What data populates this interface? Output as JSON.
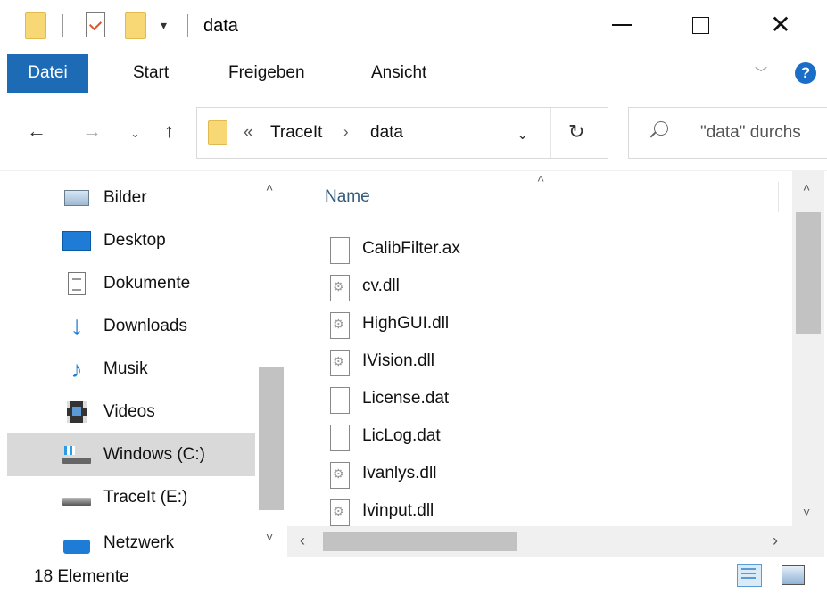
{
  "window": {
    "title": "data",
    "minimize_glyph": "—",
    "maximize_glyph": "□",
    "close_glyph": "✕"
  },
  "quick_access": {
    "dropdown_glyph": "▾"
  },
  "ribbon": {
    "tabs": [
      {
        "label": "Datei"
      },
      {
        "label": "Start"
      },
      {
        "label": "Freigeben"
      },
      {
        "label": "Ansicht"
      }
    ],
    "collapse_glyph": "﹀",
    "help_label": "?"
  },
  "nav": {
    "back_glyph": "←",
    "forward_glyph": "→",
    "recent_glyph": "⌄",
    "up_glyph": "↑"
  },
  "address": {
    "overflow": "«",
    "crumbs": [
      "TraceIt",
      "data"
    ],
    "separator": "›",
    "dropdown_glyph": "⌄",
    "refresh_glyph": "↻"
  },
  "search": {
    "placeholder": "\"data\" durchs"
  },
  "navpane": {
    "items": [
      {
        "label": "Bilder",
        "icon": "pictures-icon"
      },
      {
        "label": "Desktop",
        "icon": "desktop-icon"
      },
      {
        "label": "Dokumente",
        "icon": "documents-icon"
      },
      {
        "label": "Downloads",
        "icon": "downloads-icon"
      },
      {
        "label": "Musik",
        "icon": "music-icon"
      },
      {
        "label": "Videos",
        "icon": "videos-icon"
      },
      {
        "label": "Windows (C:)",
        "icon": "windows-drive-icon",
        "selected": true
      },
      {
        "label": "TraceIt (E:)",
        "icon": "drive-icon"
      },
      {
        "label": "Netzwerk",
        "icon": "network-icon"
      }
    ],
    "scroll_up": "˄",
    "scroll_down": "˅"
  },
  "filepane": {
    "column_name": "Name",
    "sort_glyph": "˄",
    "files": [
      {
        "name": "CalibFilter.ax",
        "type": "file"
      },
      {
        "name": "cv.dll",
        "type": "dll"
      },
      {
        "name": "HighGUI.dll",
        "type": "dll"
      },
      {
        "name": "IVision.dll",
        "type": "dll"
      },
      {
        "name": "License.dat",
        "type": "file"
      },
      {
        "name": "LicLog.dat",
        "type": "file"
      },
      {
        "name": "Ivanlys.dll",
        "type": "dll"
      },
      {
        "name": "Ivinput.dll",
        "type": "dll"
      }
    ],
    "scroll_up": "˄",
    "scroll_down": "˅",
    "scroll_left": "‹",
    "scroll_right": "›"
  },
  "status": {
    "count_text": "18 Elemente"
  },
  "colors": {
    "accent": "#1d6ab5",
    "folder": "#f8d775",
    "selection": "#d9d9d9"
  }
}
